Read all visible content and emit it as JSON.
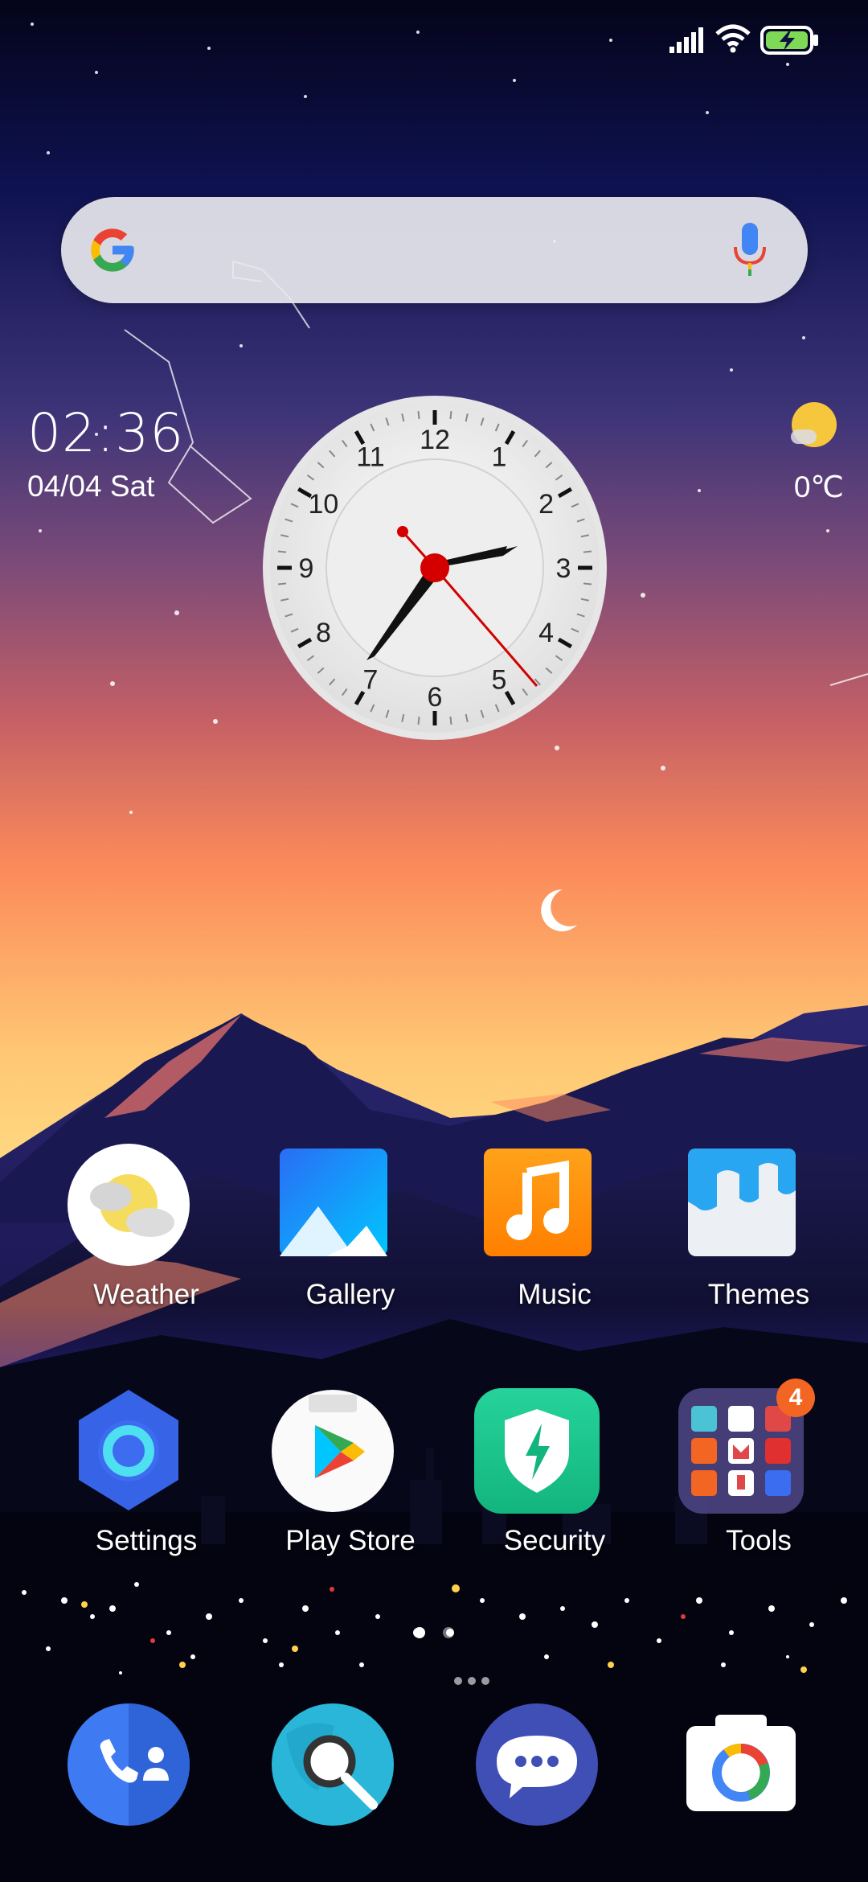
{
  "status_bar": {
    "signal_icon": "signal-icon",
    "wifi_icon": "wifi-icon",
    "battery_icon": "battery-charging-icon"
  },
  "search": {
    "logo_icon": "google-g-icon",
    "mic_icon": "mic-icon"
  },
  "clock_widget": {
    "time": "02:36",
    "date": "04/04 Sat",
    "temperature": "0℃",
    "weather_icon": "sunny-icon",
    "analog_numbers": [
      "12",
      "1",
      "2",
      "3",
      "4",
      "5",
      "6",
      "7",
      "8",
      "9",
      "10",
      "11"
    ]
  },
  "home_apps": [
    {
      "label": "Weather",
      "icon": "weather-icon"
    },
    {
      "label": "Gallery",
      "icon": "gallery-icon"
    },
    {
      "label": "Music",
      "icon": "music-icon"
    },
    {
      "label": "Themes",
      "icon": "themes-icon"
    },
    {
      "label": "Settings",
      "icon": "settings-icon"
    },
    {
      "label": "Play Store",
      "icon": "play-store-icon"
    },
    {
      "label": "Security",
      "icon": "security-icon"
    },
    {
      "label": "Tools",
      "icon": "folder-icon",
      "badge": "4"
    }
  ],
  "dock": [
    {
      "icon": "phone-icon"
    },
    {
      "icon": "browser-icon"
    },
    {
      "icon": "messages-icon"
    },
    {
      "icon": "camera-icon"
    }
  ],
  "page_indicator": {
    "pages": 3,
    "current": 1
  },
  "colors": {
    "sky_top": "#05061c",
    "sky_mid": "#a35a6e",
    "sky_low": "#fa8a5a",
    "horizon": "#ffd27a",
    "badge": "#f26522"
  }
}
